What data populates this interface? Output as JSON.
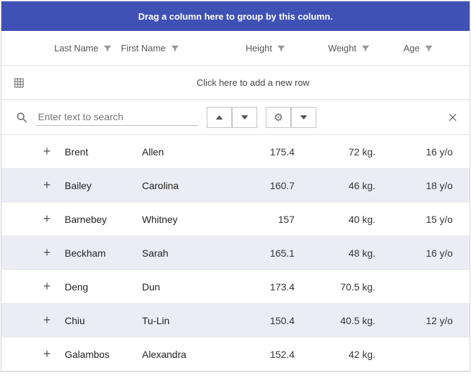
{
  "groupPanel": {
    "label": "Drag a column here to group by this column."
  },
  "columns": {
    "lastname": "Last Name",
    "firstname": "First Name",
    "height": "Height",
    "weight": "Weight",
    "age": "Age"
  },
  "newRow": {
    "label": "Click here to add a new row"
  },
  "search": {
    "placeholder": "Enter text to search"
  },
  "rows": [
    {
      "lastname": "Brent",
      "firstname": "Allen",
      "height": "175.4",
      "weight": "72 kg.",
      "age": "16 y/o"
    },
    {
      "lastname": "Bailey",
      "firstname": "Carolina",
      "height": "160.7",
      "weight": "46 kg.",
      "age": "18 y/o"
    },
    {
      "lastname": "Barnebey",
      "firstname": "Whitney",
      "height": "157",
      "weight": "40 kg.",
      "age": "15 y/o"
    },
    {
      "lastname": "Beckham",
      "firstname": "Sarah",
      "height": "165.1",
      "weight": "48 kg.",
      "age": "16 y/o"
    },
    {
      "lastname": "Deng",
      "firstname": "Dun",
      "height": "173.4",
      "weight": "70.5 kg.",
      "age": ""
    },
    {
      "lastname": "Chiu",
      "firstname": "Tu-Lin",
      "height": "150.4",
      "weight": "40.5 kg.",
      "age": "12 y/o"
    },
    {
      "lastname": "Galambos",
      "firstname": "Alexandra",
      "height": "152.4",
      "weight": "42 kg.",
      "age": ""
    }
  ],
  "chart_data": {
    "type": "table",
    "columns": [
      "Last Name",
      "First Name",
      "Height",
      "Weight",
      "Age"
    ],
    "data": [
      [
        "Brent",
        "Allen",
        175.4,
        "72 kg.",
        "16 y/o"
      ],
      [
        "Bailey",
        "Carolina",
        160.7,
        "46 kg.",
        "18 y/o"
      ],
      [
        "Barnebey",
        "Whitney",
        157,
        "40 kg.",
        "15 y/o"
      ],
      [
        "Beckham",
        "Sarah",
        165.1,
        "48 kg.",
        "16 y/o"
      ],
      [
        "Deng",
        "Dun",
        173.4,
        "70.5 kg.",
        ""
      ],
      [
        "Chiu",
        "Tu-Lin",
        150.4,
        "40.5 kg.",
        "12 y/o"
      ],
      [
        "Galambos",
        "Alexandra",
        152.4,
        "42 kg.",
        ""
      ]
    ]
  }
}
